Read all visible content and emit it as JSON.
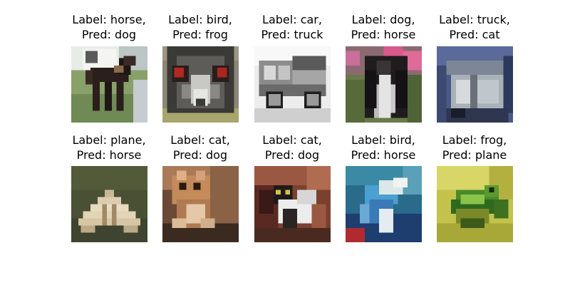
{
  "samples": [
    {
      "label_line": "Label: horse,",
      "pred_line": "Pred: dog",
      "subject": "horse-photo"
    },
    {
      "label_line": "Label: bird,",
      "pred_line": "Pred: frog",
      "subject": "bird-photo"
    },
    {
      "label_line": "Label: car,",
      "pred_line": "Pred: truck",
      "subject": "car-photo"
    },
    {
      "label_line": "Label: dog,",
      "pred_line": "Pred: horse",
      "subject": "dog-photo"
    },
    {
      "label_line": "Label: truck,",
      "pred_line": "Pred: cat",
      "subject": "truck-photo"
    },
    {
      "label_line": "Label: plane,",
      "pred_line": "Pred: horse",
      "subject": "plane-photo"
    },
    {
      "label_line": "Label: cat,",
      "pred_line": "Pred: dog",
      "subject": "cat-photo"
    },
    {
      "label_line": "Label: cat,",
      "pred_line": "Pred: dog",
      "subject": "cat-photo"
    },
    {
      "label_line": "Label: bird,",
      "pred_line": "Pred: horse",
      "subject": "bird-photo"
    },
    {
      "label_line": "Label: frog,",
      "pred_line": "Pred: plane",
      "subject": "frog-photo"
    }
  ]
}
